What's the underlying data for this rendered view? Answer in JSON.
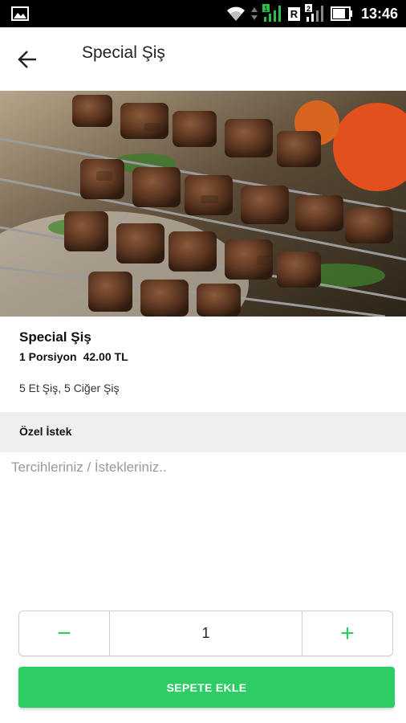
{
  "status_bar": {
    "time": "13:46",
    "sim1_label": "R",
    "sim2_label": "2",
    "icons": [
      "gallery-icon",
      "wifi-icon",
      "signal-icon",
      "signal-icon",
      "battery-icon"
    ]
  },
  "app_bar": {
    "back_icon": "arrow-left-icon",
    "title": "Special Şiş"
  },
  "product": {
    "name": "Special Şiş",
    "portion": "1 Porsiyon",
    "price": "42.00 TL",
    "description": "5 Et Şiş, 5 Ciğer Şiş"
  },
  "special_request": {
    "label": "Özel İstek",
    "placeholder": "Tercihleriniz / İstekleriniz.."
  },
  "quantity": {
    "minus": "−",
    "value": "1",
    "plus": "+"
  },
  "add_to_cart_label": "SEPETE EKLE",
  "colors": {
    "accent": "#2ecc64",
    "status_bar": "#000000",
    "section_bg": "#efefef"
  }
}
